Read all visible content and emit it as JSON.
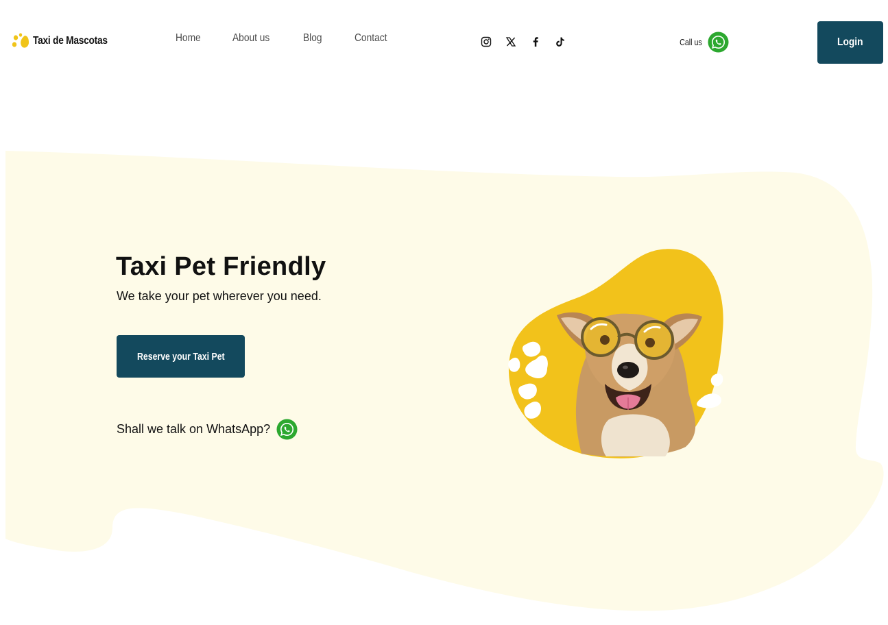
{
  "brand": {
    "name": "Taxi  de Mascotas",
    "logo_icon": "paw-icon",
    "logo_color": "#f0c419"
  },
  "nav": {
    "items": [
      "Home",
      "About us",
      "Blog",
      "Contact"
    ]
  },
  "social": {
    "icons": [
      "instagram-icon",
      "x-icon",
      "facebook-icon",
      "tiktok-icon"
    ]
  },
  "call": {
    "label": "Call us",
    "icon": "whatsapp-icon"
  },
  "login": {
    "label": "Login"
  },
  "hero": {
    "title": "Taxi Pet Friendly",
    "subtitle": "We take your pet wherever you need.",
    "cta_label": "Reserve your Taxi Pet",
    "whatsapp_label": "Shall we talk on WhatsApp?",
    "whatsapp_icon": "whatsapp-icon",
    "image": "dog-with-sunglasses-illustration"
  },
  "colors": {
    "primary": "#13495d",
    "accent_yellow": "#f2c21b",
    "hero_background": "#fefbe8",
    "whatsapp_green": "#2ca82f"
  }
}
